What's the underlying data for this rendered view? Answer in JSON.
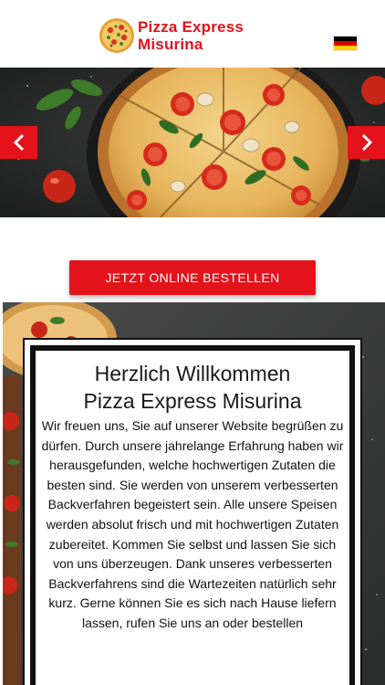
{
  "header": {
    "brand_line1": "Pizza Express",
    "brand_line2": "Misurina",
    "logo_icon": "pizza-logo-icon",
    "language_icon": "german-flag-icon"
  },
  "slider": {
    "prev_icon": "chevron-left-icon",
    "next_icon": "chevron-right-icon"
  },
  "cta": {
    "label": "JETZT ONLINE BESTELLEN"
  },
  "welcome": {
    "title_line1": "Herzlich Willkommen",
    "title_line2": "Pizza Express Misurina",
    "text": "Wir freuen uns, Sie auf unserer Website begrüßen zu dürfen. Durch unsere jahrelange Erfahrung haben wir herausgefunden, welche hochwertigen Zutaten die besten sind. Sie werden von unserem verbesserten Backverfahren begeistert sein. Alle unsere Speisen werden absolut frisch und mit hochwertigen Zutaten zubereitet. Kommen Sie selbst und lassen Sie sich von uns überzeugen. Dank unseres verbesserten Backverfahrens sind die Wartezeiten natürlich sehr kurz. Gerne können Sie es sich nach Hause liefern lassen, rufen Sie uns an oder bestellen"
  },
  "colors": {
    "accent": "#e3121b",
    "card_border": "#111111",
    "background_dark": "#3a3b3b"
  }
}
